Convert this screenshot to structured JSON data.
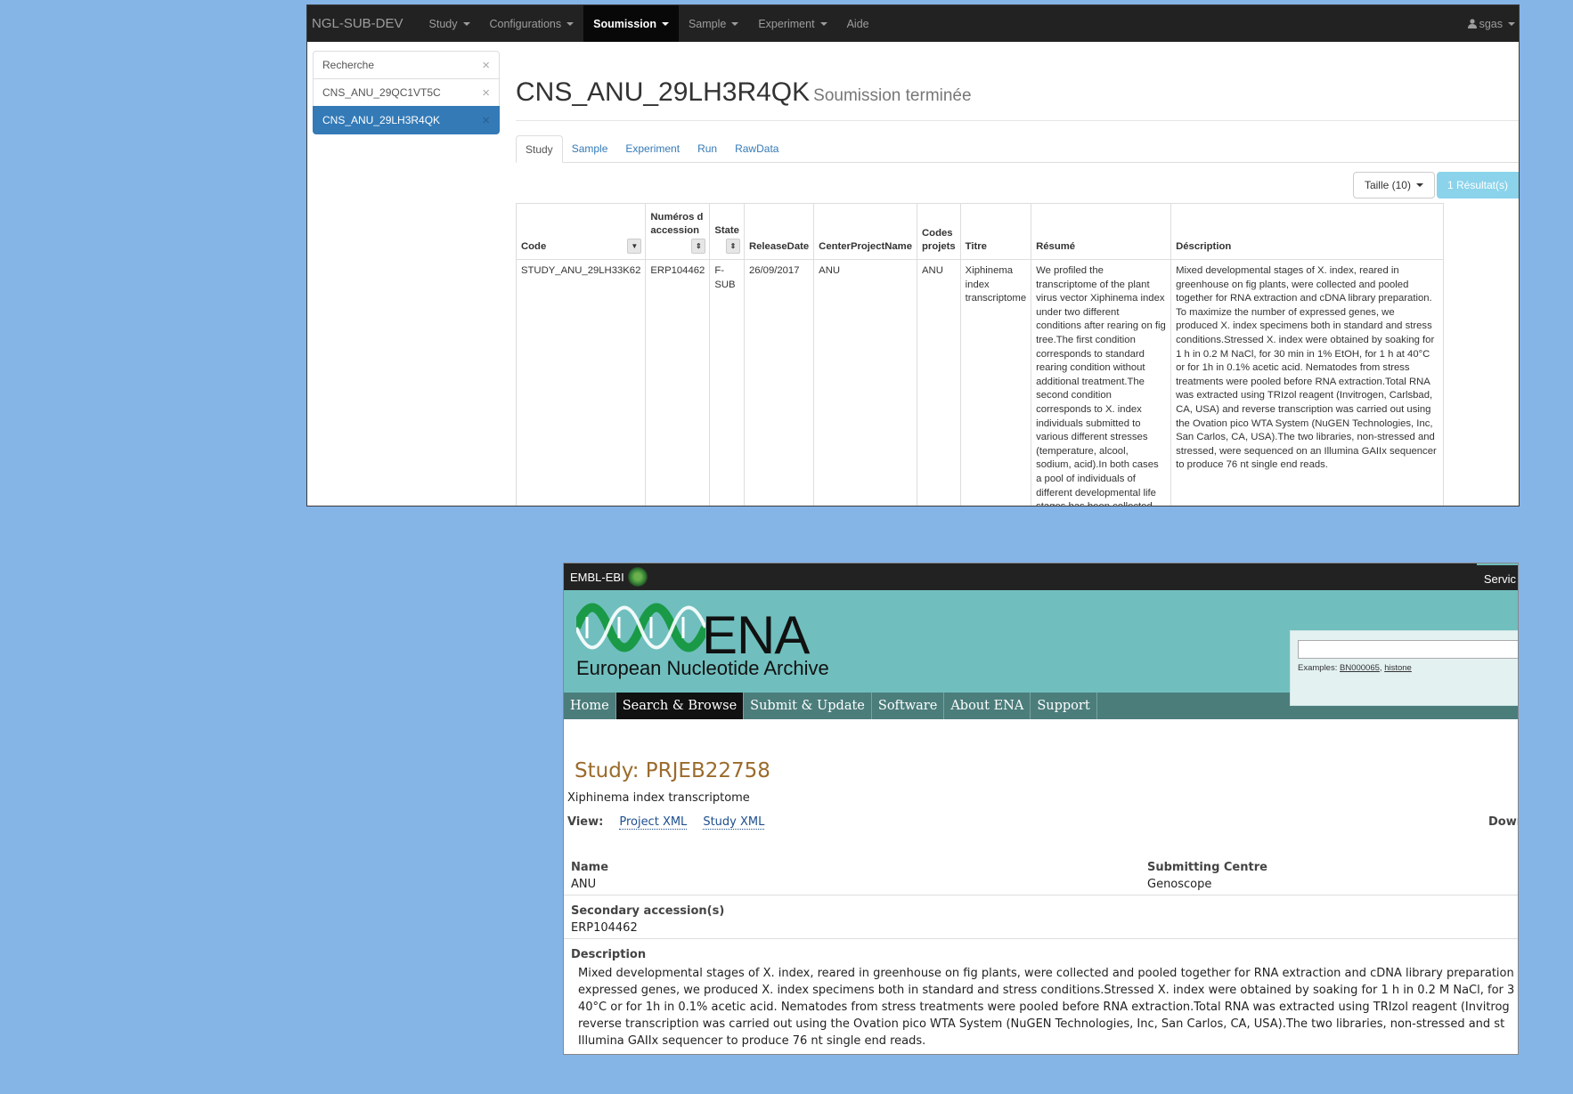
{
  "ngl": {
    "brand": "NGL-SUB-DEV",
    "nav": [
      {
        "label": "Study",
        "dropdown": true,
        "active": false
      },
      {
        "label": "Configurations",
        "dropdown": true,
        "active": false
      },
      {
        "label": "Soumission",
        "dropdown": true,
        "active": true
      },
      {
        "label": "Sample",
        "dropdown": true,
        "active": false
      },
      {
        "label": "Experiment",
        "dropdown": true,
        "active": false
      },
      {
        "label": "Aide",
        "dropdown": false,
        "active": false
      }
    ],
    "user": "sgas",
    "sidebar": [
      {
        "label": "Recherche",
        "active": false
      },
      {
        "label": "CNS_ANU_29QC1VT5C",
        "active": false
      },
      {
        "label": "CNS_ANU_29LH3R4QK",
        "active": true
      }
    ],
    "title": "CNS_ANU_29LH3R4QK",
    "subtitle": "Soumission terminée",
    "tabs": [
      "Study",
      "Sample",
      "Experiment",
      "Run",
      "RawData"
    ],
    "active_tab": "Study",
    "taille_label": "Taille (10)",
    "results_label": "1 Résultat(s)",
    "table": {
      "headers": [
        "Code",
        "Numéros d accession",
        "State",
        "ReleaseDate",
        "CenterProjectName",
        "Codes projets",
        "Titre",
        "Résumé",
        "Déscription"
      ],
      "rows": [
        [
          "STUDY_ANU_29LH33K62",
          "ERP104462",
          "F-SUB",
          "26/09/2017",
          "ANU",
          "ANU",
          "Xiphinema index transcriptome",
          "We profiled the transcriptome of the plant virus vector Xiphinema index under two different conditions after rearing on fig tree.The first condition corresponds to standard rearing condition without additional treatment.The second condition corresponds to X. index individuals submitted to various different stresses (temperature, alcool, sodium, acid).In both cases a pool of individuals of different developmental life stages has been collected.",
          "Mixed developmental stages of X. index, reared in greenhouse on fig plants, were collected and pooled together for RNA extraction and cDNA library preparation. To maximize the number of expressed genes, we produced X. index specimens both in standard and stress conditions.Stressed X. index were obtained by soaking for 1 h in 0.2 M NaCl, for 30 min in 1% EtOH, for 1 h at 40°C or for 1h in 0.1% acetic acid. Nematodes from stress treatments were pooled before RNA extraction.Total RNA was extracted using TRIzol reagent (Invitrogen, Carlsbad, CA, USA) and reverse transcription was carried out using the Ovation pico WTA System (NuGEN Technologies, Inc, San Carlos, CA, USA).The two libraries, non-stressed and stressed, were sequenced on an Illumina GAIIx sequencer to produce 76 nt single end reads."
        ]
      ]
    }
  },
  "ena": {
    "ebi_label": "EMBL-EBI",
    "services": "Servic",
    "logo_word": "ENA",
    "logo_full": "European Nucleotide Archive",
    "examples_prefix": "Examples: ",
    "example1": "BN000065",
    "example2": "histone",
    "nav": [
      {
        "label": "Home",
        "active": false
      },
      {
        "label": "Search & Browse",
        "active": true
      },
      {
        "label": "Submit & Update",
        "active": false
      },
      {
        "label": "Software",
        "active": false
      },
      {
        "label": "About ENA",
        "active": false
      },
      {
        "label": "Support",
        "active": false
      }
    ],
    "study_title": "Study: PRJEB22758",
    "study_subtitle": "Xiphinema index transcriptome",
    "view_label": "View:",
    "view_links": [
      "Project XML",
      "Study XML"
    ],
    "download_label": "Down",
    "name_label": "Name",
    "name_value": "ANU",
    "centre_label": "Submitting Centre",
    "centre_value": "Genoscope",
    "secondary_label": "Secondary accession(s)",
    "secondary_value": "ERP104462",
    "description_label": "Description",
    "description_lines": [
      "Mixed developmental stages of X. index, reared in greenhouse on fig plants, were collected and pooled together for RNA extraction and cDNA library preparation",
      "expressed genes, we produced X. index specimens both in standard and stress conditions.Stressed X. index were obtained by soaking for 1 h in 0.2 M NaCl, for 3",
      "40°C or for 1h in 0.1% acetic acid. Nematodes from stress treatments were pooled before RNA extraction.Total RNA was extracted using TRIzol reagent (Invitrog",
      "reverse transcription was carried out using the Ovation pico WTA System (NuGEN Technologies, Inc, San Carlos, CA, USA).The two libraries, non-stressed and st",
      "Illumina GAIIx sequencer to produce 76 nt single end reads."
    ]
  }
}
